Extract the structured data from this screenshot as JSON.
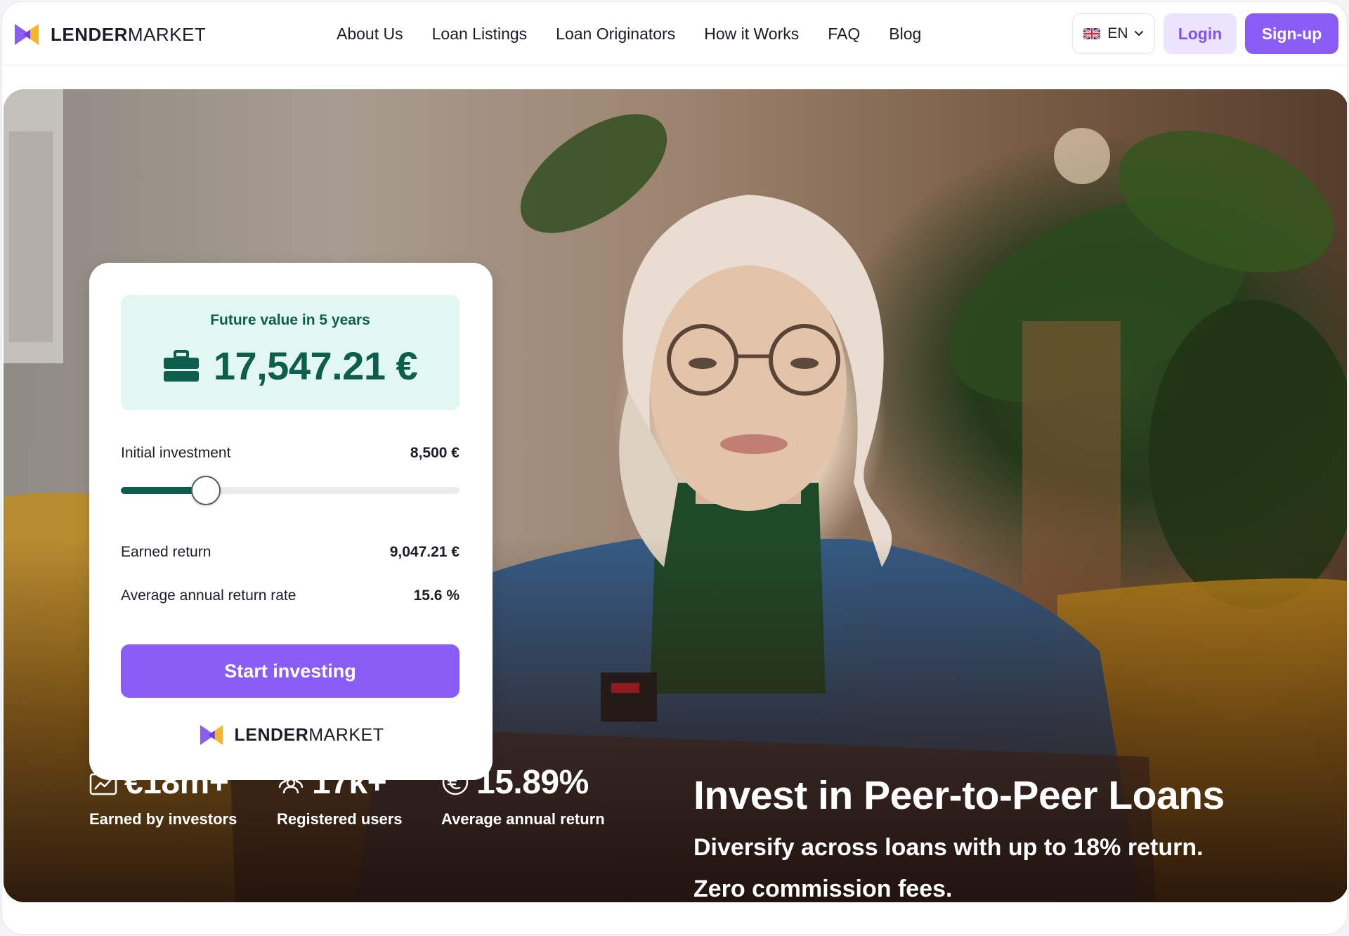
{
  "brand": {
    "name_bold": "LENDER",
    "name_regular": "MARKET"
  },
  "nav": {
    "items": [
      {
        "label": "About Us"
      },
      {
        "label": "Loan Listings"
      },
      {
        "label": "Loan Originators"
      },
      {
        "label": "How it Works"
      },
      {
        "label": "FAQ"
      },
      {
        "label": "Blog"
      }
    ]
  },
  "header": {
    "language": "EN",
    "language_icon": "uk-flag-icon",
    "login_label": "Login",
    "signup_label": "Sign-up"
  },
  "calculator": {
    "future_value_label": "Future value in 5 years",
    "future_value": "17,547.21 €",
    "future_value_icon": "briefcase-icon",
    "initial_investment_label": "Initial investment",
    "initial_investment_value": "8,500 €",
    "slider_fraction": 0.25,
    "earned_return_label": "Earned return",
    "earned_return_value": "9,047.21 €",
    "avg_rate_label": "Average annual return rate",
    "avg_rate_value": "15.6 %",
    "cta_label": "Start investing"
  },
  "stats": [
    {
      "icon": "chart-briefcase-icon",
      "value": "€18m+",
      "caption": "Earned by investors"
    },
    {
      "icon": "users-icon",
      "value": "17k+",
      "caption": "Registered users"
    },
    {
      "icon": "euro-coin-icon",
      "value": "15.89%",
      "caption": "Average annual return"
    }
  ],
  "hero": {
    "title": "Invest in Peer-to-Peer Loans",
    "subtitle": "Diversify across loans with up to 18% return.",
    "subtitle2": "Zero commission fees."
  },
  "colors": {
    "accent": "#8a5cf6",
    "accent_light": "#ece4ff",
    "green": "#0d5e4c",
    "green_light": "#e2f6f2",
    "logo_yellow": "#f7b52c",
    "logo_purple": "#8a5cf6"
  }
}
